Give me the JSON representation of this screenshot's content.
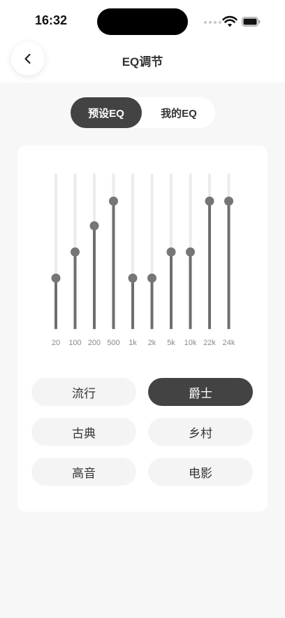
{
  "status": {
    "time": "16:32"
  },
  "nav": {
    "title": "EQ调节",
    "back_icon": "chevron-left-icon"
  },
  "segments": [
    {
      "label": "预设EQ",
      "selected": true
    },
    {
      "label": "我的EQ",
      "selected": false
    }
  ],
  "equalizer": {
    "bands": [
      {
        "label": "20",
        "level": 0.33
      },
      {
        "label": "100",
        "level": 0.5
      },
      {
        "label": "200",
        "level": 0.67
      },
      {
        "label": "500",
        "level": 0.83
      },
      {
        "label": "1k",
        "level": 0.33
      },
      {
        "label": "2k",
        "level": 0.33
      },
      {
        "label": "5k",
        "level": 0.5
      },
      {
        "label": "10k",
        "level": 0.5
      },
      {
        "label": "22k",
        "level": 0.83
      },
      {
        "label": "24k",
        "level": 0.83
      }
    ]
  },
  "presets": [
    {
      "label": "流行",
      "selected": false
    },
    {
      "label": "爵士",
      "selected": true
    },
    {
      "label": "古典",
      "selected": false
    },
    {
      "label": "乡村",
      "selected": false
    },
    {
      "label": "高音",
      "selected": false
    },
    {
      "label": "电影",
      "selected": false
    }
  ],
  "colors": {
    "accent": "#434343",
    "track": "#ececec",
    "fill": "#6e6e6e",
    "knob": "#767676",
    "background": "#f7f7f7"
  }
}
